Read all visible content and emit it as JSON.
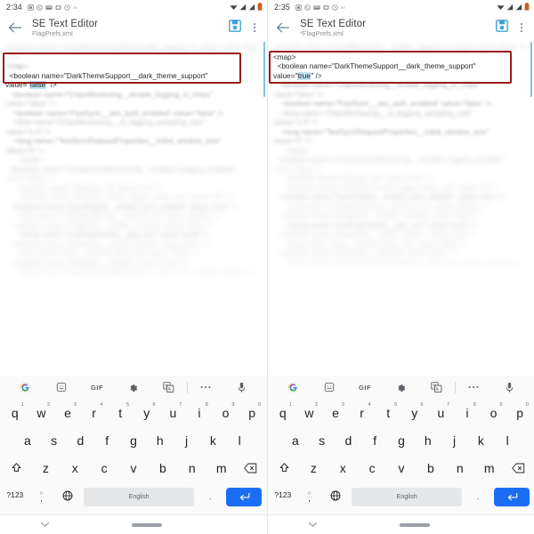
{
  "panels": [
    {
      "id": "left",
      "status": {
        "time": "2:34",
        "notification_icons": [
          "sim-icon",
          "whatsapp-icon",
          "folder-icon",
          "screenshot-icon",
          "clock-icon",
          "more-icon"
        ],
        "right_icons": [
          "wifi-icon",
          "signal-icon-1",
          "signal-icon-2",
          "battery-icon"
        ]
      },
      "appbar": {
        "back_label": "←",
        "title": "SE Text Editor",
        "subtitle": "FlagPrefs.xml",
        "save_icon": "save-icon",
        "overflow_icon": "overflow-menu-icon"
      },
      "editor": {
        "lines_above": [
          "<boolean name=\"ChipsMonitoring\\u2014enable_logging_in_chips\" value=\"false\" />",
          "<map>"
        ],
        "highlight_line_1": "  <boolean name=\"DarkThemeSupport__dark_theme_support\"",
        "highlight_line_2_prefix": "value=\"",
        "highlight_value": "false",
        "highlight_line_2_suffix": "\" />",
        "highlight_line_3": "   <boolean name=\"ChipsMonitoring__enable_logging_in_chips\"",
        "lines_below": [
          "value=\"false\" />",
          "    <boolean name=\"FastSync__ses_auth_enabled\" value=\"false\" />",
          "    <float name=\"ChipsMonitoring__ui_logging_sampling_rate\"",
          "value=\"1.0\" />",
          "    <long name=\"TestSyncRequestProperties__initial_window_size\"",
          "value=\"0\" />",
          "      </map>",
          "  <boolean name=\"ComponentsMonitoring__enabled_logging_enabled\"",
          "value=\"false\" />",
          "      <boolean name=\"Regular_off\" value=\"true\" />",
          "      <boolean name=\"Request_check_trigger_delay_ms\" value=\"10\" />",
          "   <boolean name=\"SyncEngine__enable_sync_adapter\" value=\"true\" />",
          "      <long name=\"ChipsMonitoring__interval_ms\" value=\"60000\" />",
          "   <boolean name=\"FlagStore__enable_caching\" value=\"false\" />",
          "      <string name=\"GnpRegistration__gnp_env\" value=\"prod\" />",
          "   <boolean name=\"DarkMode__follow_system\" value=\"true\" />",
          "      <long name=\"Sync__backoff_base_ms\" value=\"1000\" />",
          "   <boolean name=\"Telemetry__enabled\" value=\"false\" />",
          "      <string name=\"DepotSearchNotifications__inbox_first_results_loaded\" />"
        ],
        "scrollbar_color": "#7fc3e8"
      },
      "keyboard": {
        "toolbar": [
          "google-logo-icon",
          "sticker-icon",
          "gif-icon",
          "settings-gear-icon",
          "translate-icon",
          "more-options-icon",
          "microphone-icon"
        ],
        "gif_label": "GIF",
        "row1": [
          {
            "key": "q",
            "sup": "1"
          },
          {
            "key": "w",
            "sup": "2"
          },
          {
            "key": "e",
            "sup": "3"
          },
          {
            "key": "r",
            "sup": "4"
          },
          {
            "key": "t",
            "sup": "5"
          },
          {
            "key": "y",
            "sup": "6"
          },
          {
            "key": "u",
            "sup": "7"
          },
          {
            "key": "i",
            "sup": "8"
          },
          {
            "key": "o",
            "sup": "9"
          },
          {
            "key": "p",
            "sup": "0"
          }
        ],
        "row2": [
          "a",
          "s",
          "d",
          "f",
          "g",
          "h",
          "j",
          "k",
          "l"
        ],
        "row3": [
          "z",
          "x",
          "c",
          "v",
          "b",
          "n",
          "m"
        ],
        "shift_icon": "shift-icon",
        "backspace_icon": "backspace-icon",
        "symbols_label": "?123",
        "comma_top": "○",
        "comma_label": ",",
        "globe_icon": "globe-icon",
        "space_label": "English",
        "period_label": ".",
        "enter_icon": "enter-icon"
      },
      "navbar": {
        "chevron_icon": "chevron-down-icon",
        "home_pill": "home-pill"
      }
    },
    {
      "id": "right",
      "status": {
        "time": "2:35",
        "notification_icons": [
          "sim-icon",
          "whatsapp-icon",
          "folder-icon",
          "screenshot-icon",
          "clock-icon",
          "more-icon"
        ],
        "right_icons": [
          "wifi-icon",
          "signal-icon-1",
          "signal-icon-2",
          "battery-icon"
        ]
      },
      "appbar": {
        "back_label": "←",
        "title": "SE Text Editor",
        "subtitle": "*FlagPrefs.xml",
        "save_icon": "save-icon",
        "overflow_icon": "overflow-menu-icon"
      },
      "editor": {
        "lines_above": [
          "<boolean name=\"ChipsMonitoring__enable_logging_in_chips\" value=\"false\" />",
          "<map>"
        ],
        "highlight_line_1": "  <boolean name=\"DarkThemeSupport__dark_theme_support\"",
        "highlight_line_2_prefix": "value=\"",
        "highlight_value": "true",
        "highlight_line_2_suffix": "\" />",
        "highlight_line_3": "   <boolean name=\"ChipsMonitoring__enable_logging_in_chips\"",
        "lines_below": [
          "value=\"false\" />",
          "    <boolean name=\"FastSync__ses_auth_enabled\" value=\"false\" />",
          "    <float name=\"ChipsMonitoring__ui_logging_sampling_rate\"",
          "value=\"1.0\" />",
          "    <long name=\"TestSyncRequestProperties__initial_window_size\"",
          "value=\"0\" />",
          "      </map>",
          "  <boolean name=\"ComponentsMonitoring__enabled_logging_enabled\"",
          "value=\"false\" />",
          "      <boolean name=\"Regular_off\" value=\"true\" />",
          "      <boolean name=\"Request_check_trigger_delay_ms\" value=\"10\" />",
          "   <boolean name=\"SyncEngine__enable_sync_adapter\" value=\"true\" />",
          "      <long name=\"ChipsMonitoring__interval_ms\" value=\"60000\" />",
          "   <boolean name=\"FlagStore__enable_caching\" value=\"false\" />",
          "      <string name=\"GnpRegistration__gnp_env\" value=\"prod\" />",
          "   <boolean name=\"DarkMode__follow_system\" value=\"true\" />",
          "      <long name=\"Sync__backoff_base_ms\" value=\"1000\" />",
          "   <boolean name=\"Telemetry__enabled\" value=\"false\" />",
          "      <string name=\"DepotSearchNotifications__inbox_first_results_loaded\" />"
        ],
        "scrollbar_color": "#7fc3e8"
      },
      "keyboard": {
        "toolbar": [
          "google-logo-icon",
          "sticker-icon",
          "gif-icon",
          "settings-gear-icon",
          "translate-icon",
          "more-options-icon",
          "microphone-icon"
        ],
        "gif_label": "GIF",
        "row1": [
          {
            "key": "q",
            "sup": "1"
          },
          {
            "key": "w",
            "sup": "2"
          },
          {
            "key": "e",
            "sup": "3"
          },
          {
            "key": "r",
            "sup": "4"
          },
          {
            "key": "t",
            "sup": "5"
          },
          {
            "key": "y",
            "sup": "6"
          },
          {
            "key": "u",
            "sup": "7"
          },
          {
            "key": "i",
            "sup": "8"
          },
          {
            "key": "o",
            "sup": "9"
          },
          {
            "key": "p",
            "sup": "0"
          }
        ],
        "row2": [
          "a",
          "s",
          "d",
          "f",
          "g",
          "h",
          "j",
          "k",
          "l"
        ],
        "row3": [
          "z",
          "x",
          "c",
          "v",
          "b",
          "n",
          "m"
        ],
        "shift_icon": "shift-icon",
        "backspace_icon": "backspace-icon",
        "symbols_label": "?123",
        "comma_top": "○",
        "comma_label": ",",
        "globe_icon": "globe-icon",
        "space_label": "English",
        "period_label": ".",
        "enter_icon": "enter-icon"
      },
      "navbar": {
        "chevron_icon": "chevron-down-icon",
        "home_pill": "home-pill"
      }
    }
  ],
  "colors": {
    "accent_blue": "#4fa8d8",
    "highlight_red": "#9b1c1c",
    "selection_blue": "#bfe2f5",
    "enter_blue": "#1b6ef3",
    "scrollbar": "#7fc3e8"
  }
}
